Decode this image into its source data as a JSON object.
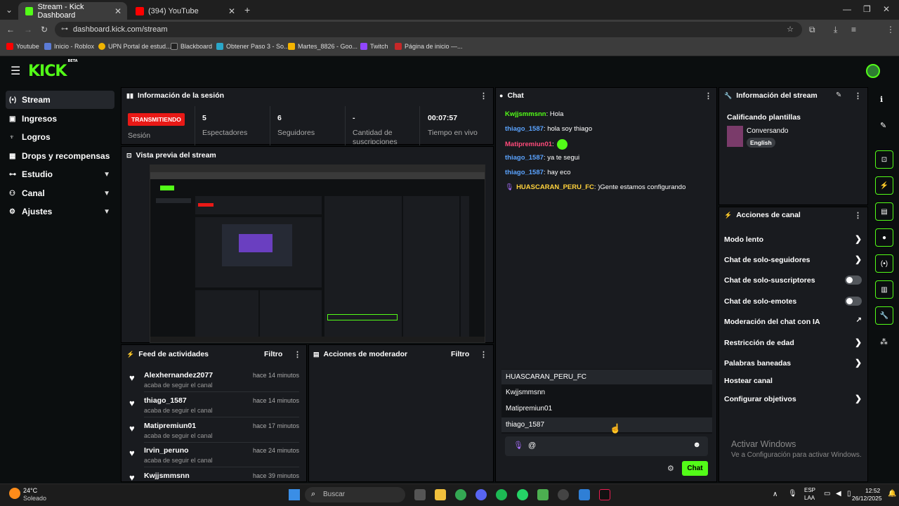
{
  "browser": {
    "tabs": [
      {
        "label": "Stream - Kick Dashboard",
        "active": true
      },
      {
        "label": "(394) YouTube",
        "active": false
      }
    ],
    "new_tab": "+",
    "url": "dashboard.kick.com/stream",
    "bookmarks": [
      "Youtube",
      "Inicio - Roblox",
      "UPN Portal de estud...",
      "Blackboard",
      "Obtener Paso 3 - So...",
      "Martes_8826 - Goo...",
      "Twitch",
      "Página de inicio —..."
    ]
  },
  "kick": {
    "logo": "KICK",
    "logo_badge": "BETA"
  },
  "sidebar": {
    "items": [
      {
        "label": "Stream",
        "icon": "broadcast-icon",
        "active": true
      },
      {
        "label": "Ingresos",
        "icon": "money-icon"
      },
      {
        "label": "Logros",
        "icon": "trophy-icon"
      },
      {
        "label": "Drops y recompensas",
        "icon": "gift-icon"
      },
      {
        "label": "Estudio",
        "icon": "studio-icon",
        "expandable": true
      },
      {
        "label": "Canal",
        "icon": "people-icon",
        "expandable": true
      },
      {
        "label": "Ajustes",
        "icon": "gear-icon",
        "expandable": true
      }
    ]
  },
  "session": {
    "title": "Información de la sesión",
    "live_badge": "TRANSMITIENDO",
    "session_label": "Sesión",
    "stats": [
      {
        "value": "5",
        "label": "Espectadores"
      },
      {
        "value": "6",
        "label": "Seguidores"
      },
      {
        "value": "-",
        "label": "Cantidad de suscripciones"
      },
      {
        "value": "00:07:57",
        "label": "Tiempo en vivo"
      }
    ]
  },
  "preview": {
    "title": "Vista previa del stream"
  },
  "feed": {
    "title": "Feed de actividades",
    "filter": "Filtro",
    "items": [
      {
        "name": "Alexhernandez2077",
        "sub": "acaba de seguir el canal",
        "time": "hace 14 minutos"
      },
      {
        "name": "thiago_1587",
        "sub": "acaba de seguir el canal",
        "time": "hace 14 minutos"
      },
      {
        "name": "Matipremiun01",
        "sub": "acaba de seguir el canal",
        "time": "hace 17 minutos"
      },
      {
        "name": "Irvin_peruno",
        "sub": "acaba de seguir el canal",
        "time": "hace 24 minutos"
      },
      {
        "name": "Kwjjsmmsnn",
        "sub": "",
        "time": "hace 39 minutos"
      }
    ]
  },
  "mod": {
    "title": "Acciones de moderador",
    "filter": "Filtro"
  },
  "chat": {
    "title": "Chat",
    "messages": [
      {
        "user": "Kwjjsmmsnn",
        "text": ": Hola",
        "color": "#53fc18"
      },
      {
        "user": "thiago_1587",
        "text": ": hola soy thiago",
        "color": "#5aa3ff"
      },
      {
        "user": "Matipremiun01",
        "text": ":",
        "color": "#ff4a7a"
      },
      {
        "user": "thiago_1587",
        "text": ": ya te segui",
        "color": "#5aa3ff"
      },
      {
        "user": "thiago_1587",
        "text": ": hay eco",
        "color": "#5aa3ff"
      },
      {
        "user": "HUASCARAN_PERU_FC",
        "text": ": )Gente estamos configurando",
        "color": "#ffd23c"
      }
    ],
    "suggestions": [
      "HUASCARAN_PERU_FC",
      "Kwjjsmmsnn",
      "Matipremiun01",
      "thiago_1587"
    ],
    "input_value": "@",
    "send_label": "Chat"
  },
  "stream_info": {
    "title": "Información del stream",
    "stream_title": "Calificando plantillas",
    "category": "Conversando",
    "language": "English"
  },
  "channel_actions": {
    "title": "Acciones de canal",
    "items": [
      {
        "label": "Modo lento",
        "control": "chevron"
      },
      {
        "label": "Chat de solo-seguidores",
        "control": "chevron"
      },
      {
        "label": "Chat de solo-suscriptores",
        "control": "toggle"
      },
      {
        "label": "Chat de solo-emotes",
        "control": "toggle"
      },
      {
        "label": "Moderación del chat con IA",
        "control": "external"
      },
      {
        "label": "Restricción de edad",
        "control": "chevron"
      },
      {
        "label": "Palabras baneadas",
        "control": "chevron"
      },
      {
        "label": "Hostear canal",
        "control": "none"
      },
      {
        "label": "Configurar objetivos",
        "control": "chevron"
      }
    ]
  },
  "watermark": {
    "line1": "Activar Windows",
    "line2": "Ve a Configuración para activar Windows."
  },
  "taskbar": {
    "weather_temp": "24°C",
    "weather_desc": "Soleado",
    "search_placeholder": "Buscar",
    "lang": "ESP",
    "lang2": "LAA",
    "time": "12:52",
    "date": "26/12/2025"
  },
  "colors": {
    "kick_green": "#53fc18",
    "live_red": "#e91916",
    "panel_bg": "#191b1f"
  }
}
